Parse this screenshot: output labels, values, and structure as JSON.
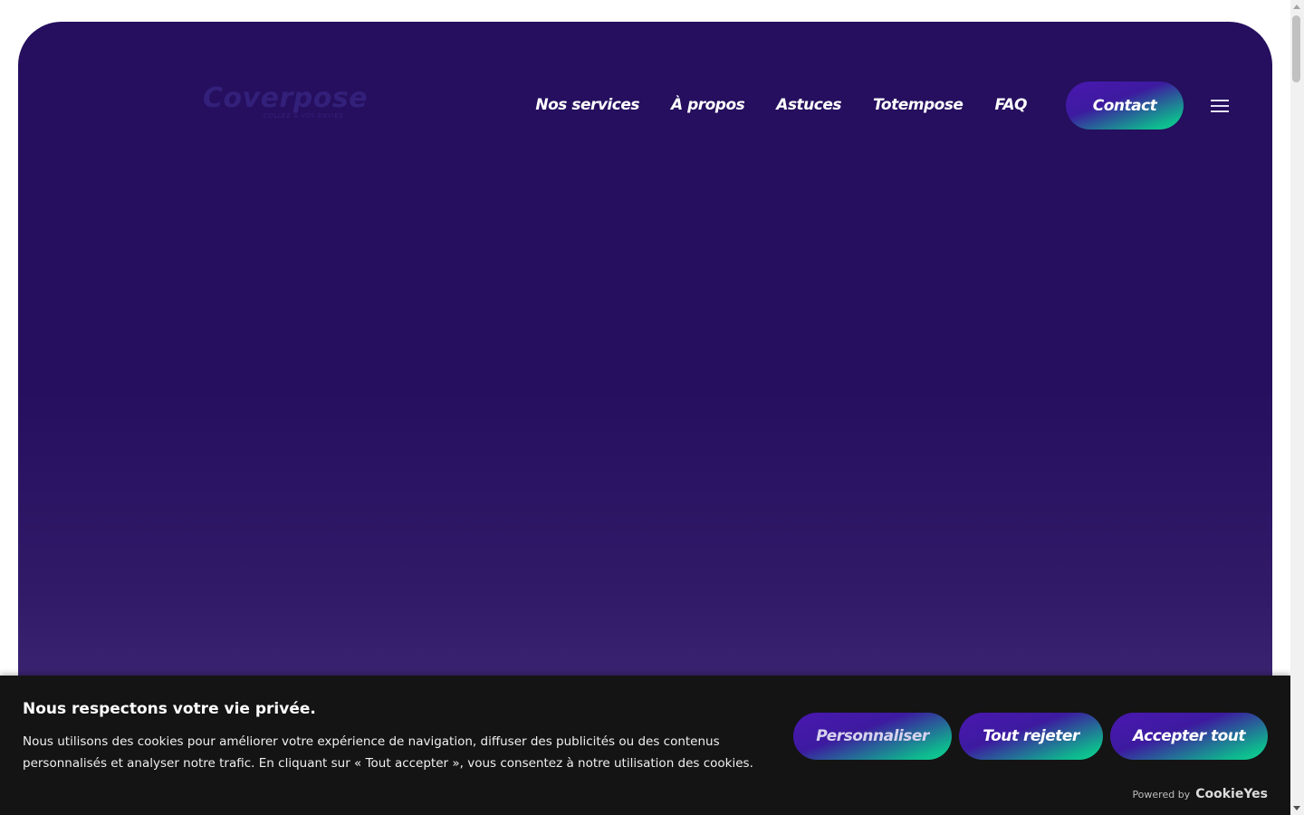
{
  "header": {
    "logo": {
      "name": "Coverpose",
      "tagline": "COLLEZ À VOS ENVIES"
    },
    "nav": [
      {
        "label": "Nos services"
      },
      {
        "label": "À propos"
      },
      {
        "label": "Astuces"
      },
      {
        "label": "Totempose"
      },
      {
        "label": "FAQ"
      }
    ],
    "contact_label": "Contact",
    "menu_icon": "hamburger-menu-icon"
  },
  "cookie_banner": {
    "title": "Nous respectons votre vie privée.",
    "text": "Nous utilisons des cookies pour améliorer votre expérience de navigation, diffuser des publicités ou des contenus personnalisés et analyser notre trafic. En cliquant sur « Tout accepter », vous consentez à notre utilisation des cookies.",
    "buttons": {
      "customize": "Personnaliser",
      "reject": "Tout rejeter",
      "accept": "Accepter tout"
    },
    "powered_by_label": "Powered by",
    "powered_by_brand": "CookieYes"
  },
  "colors": {
    "hero_background": "#250f5e",
    "accent_purple": "#4a18b0",
    "accent_green": "#10d693",
    "banner_background": "#141414"
  }
}
